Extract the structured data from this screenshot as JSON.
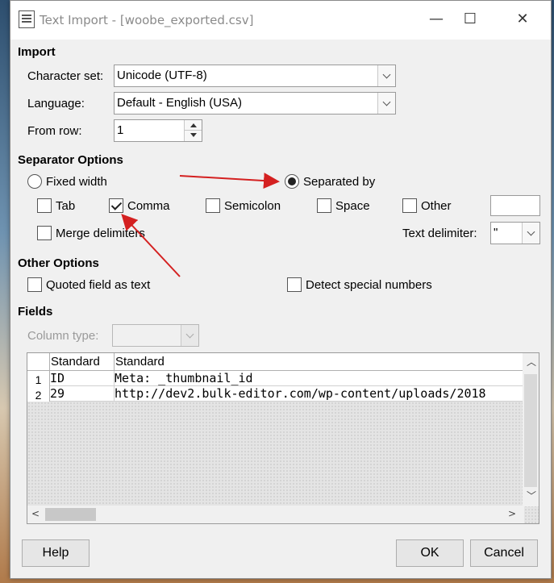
{
  "window": {
    "title": "Text Import - [woobe_exported.csv]",
    "minimize": "—",
    "maximize": "☐",
    "close": "✕"
  },
  "import": {
    "section": "Import",
    "charset_label": "Character set:",
    "charset_value": "Unicode (UTF-8)",
    "language_label": "Language:",
    "language_value": "Default - English (USA)",
    "from_row_label": "From row:",
    "from_row_value": "1"
  },
  "separator": {
    "section": "Separator Options",
    "fixed_width": "Fixed width",
    "separated_by": "Separated by",
    "tab": "Tab",
    "comma": "Comma",
    "semicolon": "Semicolon",
    "space": "Space",
    "other": "Other",
    "merge": "Merge delimiters",
    "text_delim_label": "Text delimiter:",
    "text_delim_value": "\""
  },
  "other_options": {
    "section": "Other Options",
    "quoted": "Quoted field as text",
    "detect": "Detect special numbers"
  },
  "fields": {
    "section": "Fields",
    "column_type_label": "Column type:",
    "headers": [
      "Standard",
      "Standard"
    ],
    "rows": [
      {
        "num": "1",
        "c1": "ID",
        "c2": "Meta: _thumbnail_id"
      },
      {
        "num": "2",
        "c1": "29",
        "c2": "http://dev2.bulk-editor.com/wp-content/uploads/2018"
      }
    ]
  },
  "buttons": {
    "help": "Help",
    "ok": "OK",
    "cancel": "Cancel"
  },
  "colors": {
    "annotation": "#d42020"
  }
}
